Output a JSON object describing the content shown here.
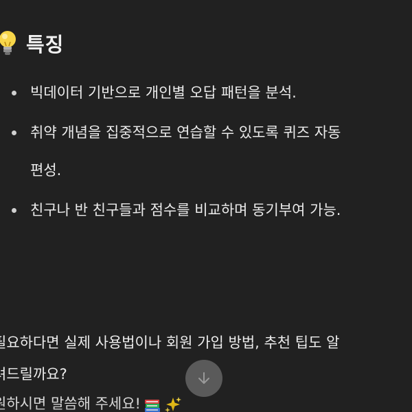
{
  "section": {
    "heading": "특징",
    "heading_icon": "light-bulb-icon",
    "features": [
      {
        "lines": [
          "빅데이터 기반으로 개인별 오답 패턴을 분석."
        ]
      },
      {
        "lines": [
          "취약 개념을 집중적으로 연습할 수 있도록 퀴즈 자동",
          "편성."
        ]
      },
      {
        "lines": [
          "친구나 반 친구들과 점수를 비교하며 동기부여 가능."
        ]
      }
    ]
  },
  "closing": {
    "line1": "필요하다면 실제 사용법이나 회원 가입 방법, 추천 팁도 알",
    "line2": "려드릴까요?",
    "line3": "원하시면 말씀해 주세요!",
    "emojis": [
      "books-icon",
      "sparkles-icon"
    ]
  },
  "scroll_button": {
    "icon": "arrow-down-icon"
  },
  "colors": {
    "background": "#212121",
    "text": "#ececec",
    "scroll_button": "#5f5f5f"
  }
}
